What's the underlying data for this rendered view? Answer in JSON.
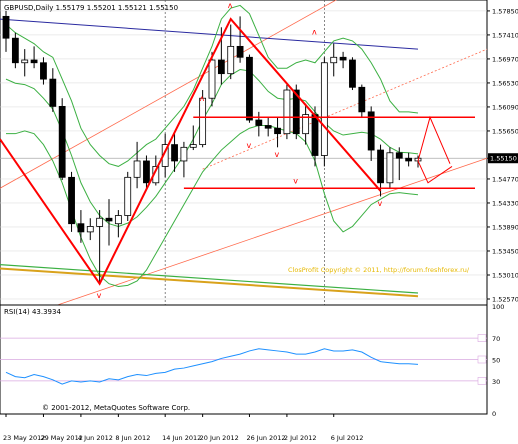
{
  "chart_data": [
    {
      "type": "candlestick",
      "title": "GBPUSD,Daily  1.55179 1.55201 1.55121 1.55150",
      "symbol": "GBPUSD",
      "timeframe": "Daily",
      "ohlc_header": {
        "open": 1.55179,
        "high": 1.55201,
        "low": 1.55121,
        "close": 1.5515
      },
      "price_axis": {
        "ticks": [
          1.5785,
          1.5741,
          1.5697,
          1.5653,
          1.5609,
          1.5565,
          1.5515,
          1.5477,
          1.5433,
          1.5389,
          1.5345,
          1.5301,
          1.5257
        ],
        "current_price": 1.5515,
        "ylim": [
          1.5246,
          1.5805
        ]
      },
      "time_axis": {
        "labels": [
          "23 May 2012",
          "29 May 2012",
          "4 Jun 2012",
          "8 Jun 2012",
          "14 Jun 2012",
          "20 Jun 2012",
          "26 Jun 2012",
          "2 Jul 2012",
          "6 Jul 2012"
        ]
      },
      "candles": [
        {
          "o": 1.5775,
          "h": 1.5785,
          "l": 1.571,
          "c": 1.5735
        },
        {
          "o": 1.5735,
          "h": 1.5745,
          "l": 1.568,
          "c": 1.569
        },
        {
          "o": 1.569,
          "h": 1.5715,
          "l": 1.5665,
          "c": 1.5695
        },
        {
          "o": 1.5695,
          "h": 1.572,
          "l": 1.568,
          "c": 1.569
        },
        {
          "o": 1.569,
          "h": 1.57,
          "l": 1.565,
          "c": 1.566
        },
        {
          "o": 1.566,
          "h": 1.568,
          "l": 1.56,
          "c": 1.561
        },
        {
          "o": 1.561,
          "h": 1.5625,
          "l": 1.5475,
          "c": 1.548
        },
        {
          "o": 1.548,
          "h": 1.549,
          "l": 1.538,
          "c": 1.5395
        },
        {
          "o": 1.5395,
          "h": 1.542,
          "l": 1.536,
          "c": 1.538
        },
        {
          "o": 1.538,
          "h": 1.5405,
          "l": 1.5365,
          "c": 1.539
        },
        {
          "o": 1.539,
          "h": 1.542,
          "l": 1.5285,
          "c": 1.5405
        },
        {
          "o": 1.5405,
          "h": 1.544,
          "l": 1.5355,
          "c": 1.54
        },
        {
          "o": 1.5395,
          "h": 1.542,
          "l": 1.537,
          "c": 1.541
        },
        {
          "o": 1.541,
          "h": 1.549,
          "l": 1.54,
          "c": 1.548
        },
        {
          "o": 1.548,
          "h": 1.5545,
          "l": 1.546,
          "c": 1.551
        },
        {
          "o": 1.551,
          "h": 1.552,
          "l": 1.546,
          "c": 1.547
        },
        {
          "o": 1.547,
          "h": 1.552,
          "l": 1.5465,
          "c": 1.55
        },
        {
          "o": 1.55,
          "h": 1.556,
          "l": 1.548,
          "c": 1.554
        },
        {
          "o": 1.554,
          "h": 1.556,
          "l": 1.549,
          "c": 1.551
        },
        {
          "o": 1.551,
          "h": 1.5545,
          "l": 1.548,
          "c": 1.5535
        },
        {
          "o": 1.5535,
          "h": 1.5575,
          "l": 1.553,
          "c": 1.554
        },
        {
          "o": 1.554,
          "h": 1.564,
          "l": 1.5535,
          "c": 1.5625
        },
        {
          "o": 1.5625,
          "h": 1.571,
          "l": 1.561,
          "c": 1.5695
        },
        {
          "o": 1.5695,
          "h": 1.5755,
          "l": 1.565,
          "c": 1.567
        },
        {
          "o": 1.567,
          "h": 1.576,
          "l": 1.566,
          "c": 1.572
        },
        {
          "o": 1.572,
          "h": 1.5775,
          "l": 1.569,
          "c": 1.57
        },
        {
          "o": 1.57,
          "h": 1.5705,
          "l": 1.558,
          "c": 1.5585
        },
        {
          "o": 1.5585,
          "h": 1.56,
          "l": 1.5555,
          "c": 1.5575
        },
        {
          "o": 1.5575,
          "h": 1.559,
          "l": 1.5555,
          "c": 1.557
        },
        {
          "o": 1.557,
          "h": 1.559,
          "l": 1.5535,
          "c": 1.556
        },
        {
          "o": 1.556,
          "h": 1.565,
          "l": 1.555,
          "c": 1.564
        },
        {
          "o": 1.564,
          "h": 1.565,
          "l": 1.555,
          "c": 1.556
        },
        {
          "o": 1.556,
          "h": 1.5615,
          "l": 1.554,
          "c": 1.5595
        },
        {
          "o": 1.5595,
          "h": 1.561,
          "l": 1.55,
          "c": 1.552
        },
        {
          "o": 1.552,
          "h": 1.57,
          "l": 1.55,
          "c": 1.569
        },
        {
          "o": 1.569,
          "h": 1.5725,
          "l": 1.5665,
          "c": 1.57
        },
        {
          "o": 1.57,
          "h": 1.571,
          "l": 1.568,
          "c": 1.5695
        },
        {
          "o": 1.5695,
          "h": 1.57,
          "l": 1.564,
          "c": 1.5645
        },
        {
          "o": 1.5645,
          "h": 1.565,
          "l": 1.559,
          "c": 1.56
        },
        {
          "o": 1.56,
          "h": 1.561,
          "l": 1.551,
          "c": 1.553
        },
        {
          "o": 1.553,
          "h": 1.554,
          "l": 1.5445,
          "c": 1.547
        },
        {
          "o": 1.547,
          "h": 1.5535,
          "l": 1.546,
          "c": 1.5525
        },
        {
          "o": 1.5525,
          "h": 1.5535,
          "l": 1.5475,
          "c": 1.5515
        },
        {
          "o": 1.5515,
          "h": 1.5525,
          "l": 1.55,
          "c": 1.551
        },
        {
          "o": 1.551,
          "h": 1.552,
          "l": 1.5498,
          "c": 1.5515
        }
      ],
      "fractal_marker": "ʌ",
      "watermark": "ClosProfit Copyright © 2011, http://forum.freshforex.ru/",
      "colors": {
        "zigzag": "#ff0000",
        "bands": "#3cb043",
        "ma_fast": "#2a2aa0",
        "ma_slow": "#d9a21b",
        "channel": "#ff6a4d",
        "grid": "#d8d8d8"
      }
    },
    {
      "type": "line",
      "title": "RSI(14) 43.3934",
      "indicator": "RSI(14)",
      "value": 43.3934,
      "ylim": [
        0,
        100
      ],
      "scale_labels": [
        "100",
        "70",
        "50",
        "30",
        "0"
      ],
      "levels": [
        70,
        50,
        30
      ],
      "values": [
        38,
        34,
        33,
        36,
        34,
        31,
        27,
        30,
        29,
        30,
        29,
        32,
        31,
        34,
        36,
        35,
        37,
        38,
        41,
        42,
        44,
        46,
        48,
        51,
        53,
        55,
        58,
        60,
        59,
        58,
        57,
        55,
        55,
        57,
        60,
        58,
        58,
        59,
        57,
        52,
        48,
        47,
        46,
        46,
        45.5
      ],
      "copyright": "© 2001-2012, MetaQuotes Software Corp."
    }
  ]
}
